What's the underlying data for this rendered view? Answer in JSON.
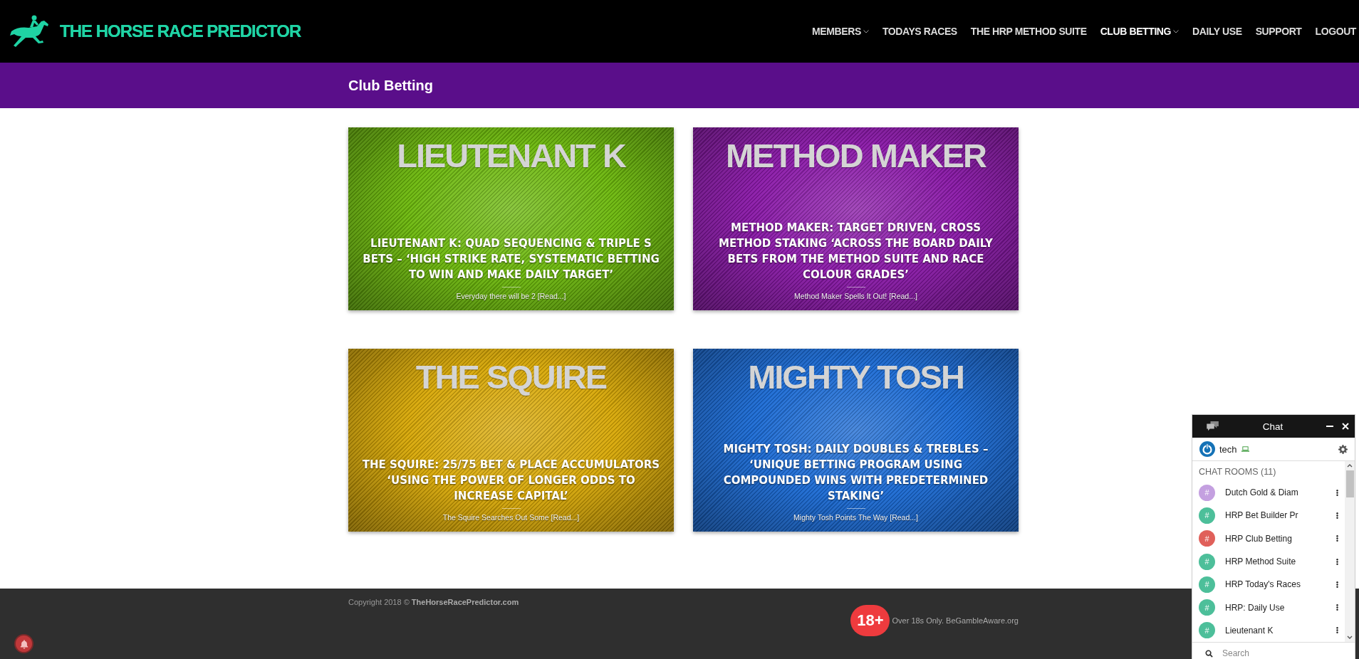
{
  "header": {
    "logo_text": "THE HORSE RACE PREDICTOR",
    "nav": [
      {
        "label": "MEMBERS",
        "has_dropdown": true,
        "selected": false
      },
      {
        "label": "TODAYS RACES",
        "has_dropdown": false,
        "selected": false
      },
      {
        "label": "THE HRP METHOD SUITE",
        "has_dropdown": false,
        "selected": false
      },
      {
        "label": "CLUB BETTING",
        "has_dropdown": true,
        "selected": true
      },
      {
        "label": "DAILY USE",
        "has_dropdown": false,
        "selected": false
      },
      {
        "label": "SUPPORT",
        "has_dropdown": false,
        "selected": false
      },
      {
        "label": "LOGOUT",
        "has_dropdown": false,
        "selected": false
      }
    ]
  },
  "page_title": "Club Betting",
  "posts": [
    {
      "banner": "LIEUTENANT K",
      "color": "#6cb80c",
      "title": "LIEUTENANT K: QUAD SEQUENCING & TRIPLE S BETS – ‘HIGH STRIKE RATE, SYSTEMATIC BETTING TO WIN AND MAKE DAILY TARGET’",
      "excerpt": "Everyday there will be 2",
      "read_more": "[Read...]"
    },
    {
      "banner": "METHOD MAKER",
      "color": "#8a18a8",
      "title": "METHOD MAKER: TARGET DRIVEN, CROSS METHOD STAKING ‘ACROSS THE BOARD DAILY BETS FROM THE METHOD SUITE AND RACE COLOUR GRADES’",
      "excerpt": "Method Maker Spells It Out!",
      "read_more": "[Read...]"
    },
    {
      "banner": "THE SQUIRE",
      "color": "#d8a806",
      "title": "THE SQUIRE: 25/75 BET & PLACE ACCUMULATORS ‘USING THE POWER OF LONGER ODDS TO INCREASE CAPITAL’",
      "excerpt": "The Squire Searches Out Some",
      "read_more": "[Read...]"
    },
    {
      "banner": "MIGHTY TOSH",
      "color": "#1a6ad4",
      "title": "MIGHTY TOSH: DAILY DOUBLES & TREBLES – ‘UNIQUE BETTING PROGRAM USING COMPOUNDED WINS WITH PREDETERMINED STAKING’",
      "excerpt": "Mighty Tosh Points The Way",
      "read_more": "[Read...]"
    }
  ],
  "footer": {
    "copyright": "Copyright 2018 © **TheHorseRacePredictor.com**",
    "age_badge": "18+",
    "notice": "Over 18s Only. BeGambleAware.org"
  },
  "chat": {
    "title": "Chat",
    "user": "tech",
    "rooms_heading": "CHAT ROOMS (11)",
    "rooms": [
      {
        "name": "Dutch Gold & Diam",
        "color": "#c4a0e0"
      },
      {
        "name": "HRP Bet Builder Pr",
        "color": "#4dbf9a"
      },
      {
        "name": "HRP Club Betting",
        "color": "#e0605a"
      },
      {
        "name": "HRP Method Suite",
        "color": "#4dbf9a"
      },
      {
        "name": "HRP Today's Races",
        "color": "#4dbf9a"
      },
      {
        "name": "HRP: Daily Use",
        "color": "#4dbf9a"
      },
      {
        "name": "Lieutenant K",
        "color": "#4dbf9a"
      }
    ],
    "room_icon": "#",
    "search": {
      "placeholder": "Search"
    }
  }
}
